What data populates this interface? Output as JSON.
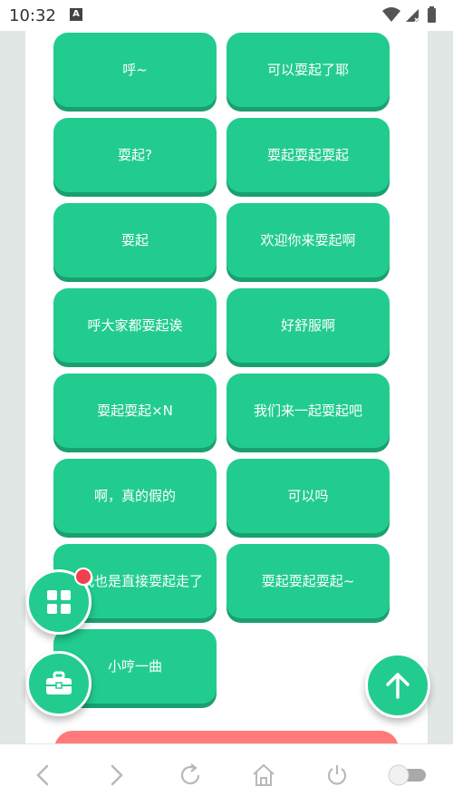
{
  "status_bar": {
    "time": "10:32",
    "notification_letter": "A"
  },
  "buttons": [
    "呼~",
    "可以耍起了耶",
    "耍起?",
    "耍起耍起耍起",
    "耍起",
    "欢迎你来耍起啊",
    "呼大家都耍起诶",
    "好舒服啊",
    "耍起耍起×N",
    "我们来一起耍起吧",
    "啊，真的假的",
    "可以吗",
    "那我也是直接耍起走了",
    "耍起耍起耍起~",
    "小哼一曲"
  ],
  "colors": {
    "button": "#22cc8f",
    "button_shadow": "#1aa06f",
    "badge": "#f0404f",
    "bottom_bar": "#ff7b7b"
  },
  "fabs": {
    "grid": "grid-icon",
    "toolbox": "toolbox-icon",
    "scroll_top": "arrow-up-icon"
  },
  "nav_icons": [
    "back-icon",
    "forward-icon",
    "refresh-icon",
    "home-icon",
    "power-icon",
    "toggle-switch"
  ]
}
